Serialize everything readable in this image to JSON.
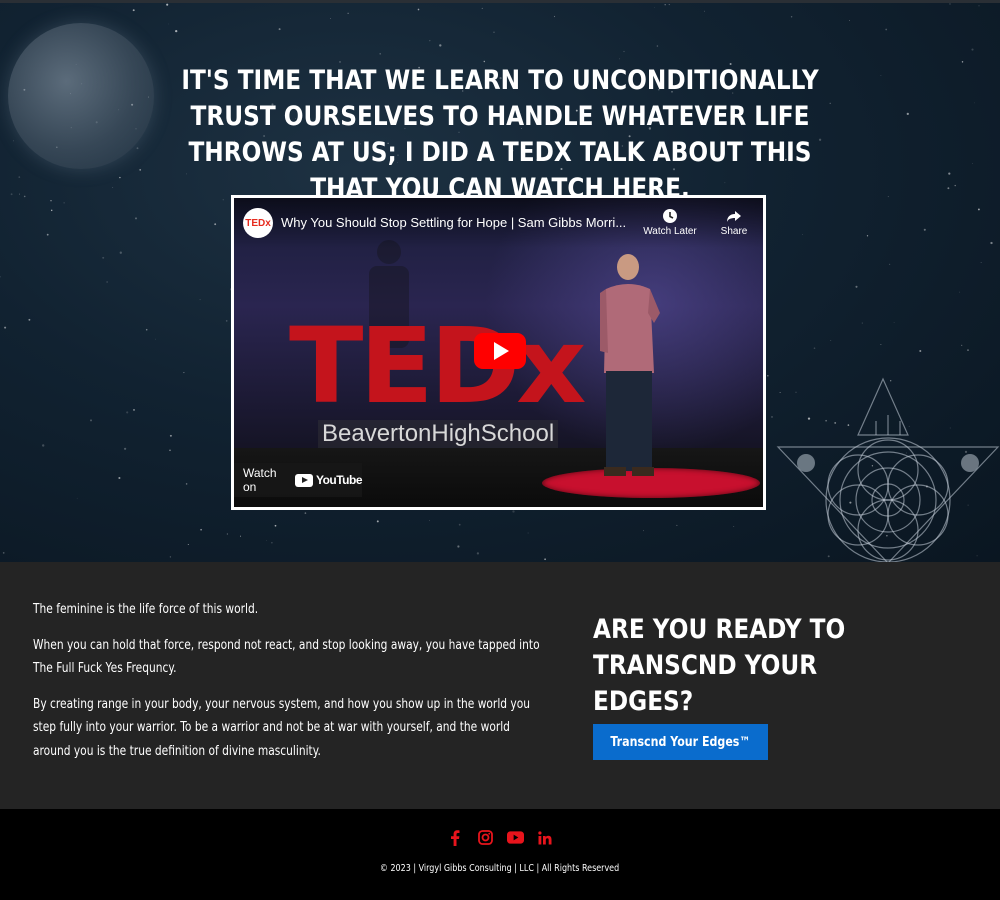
{
  "hero": {
    "headline": "IT'S TIME THAT WE LEARN TO UNCONDITIONALLY TRUST OURSELVES TO HANDLE WHATEVER LIFE THROWS AT US; I DID A TEDX TALK ABOUT THIS THAT YOU CAN WATCH HERE."
  },
  "video": {
    "channel_logo": "TEDx",
    "title": "Why You Should Stop Settling for Hope | Sam Gibbs Morri...",
    "watch_later_label": "Watch Later",
    "share_label": "Share",
    "stage_text": "TEDx",
    "venue_text": "BeavertonHighSchool",
    "watch_on_label": "Watch on",
    "youtube_label": "YouTube",
    "icons": {
      "watch_later": "clock-icon",
      "share": "share-arrow-icon",
      "play": "play-icon"
    }
  },
  "content": {
    "paragraphs": [
      "The feminine is the life force of this world.",
      "When you can hold that force, respond not react, and stop looking away, you have tapped into The Full Fuck Yes Frequncy.",
      "By creating range in your body, your nervous system, and how you show up in the world you step fully into your warrior. To be a warrior and not be at war with yourself, and the world around you is the true definition of divine masculinity."
    ]
  },
  "cta": {
    "title": "ARE YOU READY TO TRANSCND YOUR EDGES?",
    "button_label": "Transcnd Your Edges™",
    "button_color": "#0a6ccd"
  },
  "footer": {
    "social_icons": [
      "facebook-icon",
      "instagram-icon",
      "youtube-icon",
      "linkedin-icon"
    ],
    "icon_color": "#e8141c",
    "copyright": "© 2023 | Virgyl Gibbs Consulting | LLC | All Rights Reserved"
  }
}
